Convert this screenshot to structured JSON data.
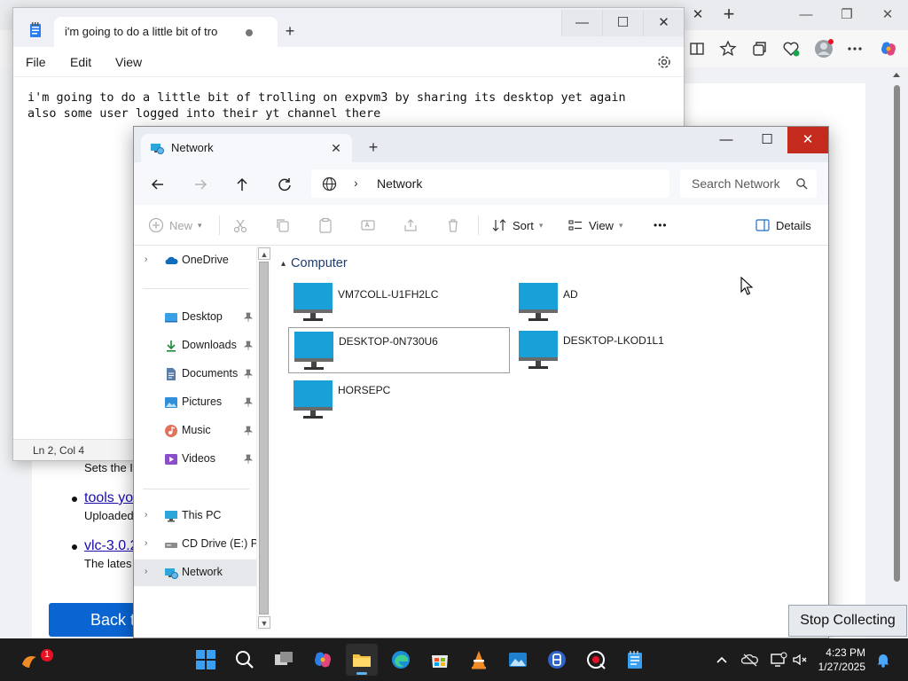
{
  "browser": {
    "tab_close": "✕",
    "new_tab": "+",
    "window_buttons": [
      "—",
      "❐",
      "✕"
    ],
    "web_texts": [
      "Sets the I",
      "Uploaded",
      "The lates"
    ],
    "links": [
      "tools yo",
      "vlc-3.0.2"
    ],
    "back_button": "Back to H"
  },
  "notepad": {
    "tab_title": "i'm going to do a little bit of tro",
    "add_tab": "+",
    "window_buttons": [
      "—",
      "☐",
      "✕"
    ],
    "menu": [
      "File",
      "Edit",
      "View"
    ],
    "text_lines": [
      "i'm going to do a little bit of trolling on expvm3 by sharing its desktop yet again",
      "also some user logged into their yt channel there"
    ],
    "status_position": "Ln 2, Col 4"
  },
  "explorer": {
    "tab_title": "Network",
    "tab_close": "✕",
    "add_tab": "+",
    "window_buttons": [
      "—",
      "☐",
      "✕"
    ],
    "address": "Network",
    "address_chevron": "›",
    "search_placeholder": "Search Network",
    "commands": {
      "new": "New",
      "sort": "Sort",
      "view": "View",
      "more": "•••",
      "details": "Details"
    },
    "nav_items": [
      {
        "label": "OneDrive",
        "icon": "cloud-icon",
        "expand": "›"
      },
      {
        "label": "Desktop",
        "icon": "desktop-folder-icon"
      },
      {
        "label": "Downloads",
        "icon": "download-icon"
      },
      {
        "label": "Documents",
        "icon": "documents-icon"
      },
      {
        "label": "Pictures",
        "icon": "pictures-icon"
      },
      {
        "label": "Music",
        "icon": "music-icon"
      },
      {
        "label": "Videos",
        "icon": "videos-icon"
      },
      {
        "label": "This PC",
        "icon": "computer-icon",
        "expand": "›"
      },
      {
        "label": "CD Drive (E:) PV",
        "icon": "cd-drive-icon",
        "expand": "›"
      },
      {
        "label": "Network",
        "icon": "network-icon",
        "expand": "›",
        "selected": true
      }
    ],
    "group_title": "Computer",
    "group_caret": "▴",
    "devices": [
      "VM7COLL-U1FH2LC",
      "AD",
      "DESKTOP-0N730U6",
      "DESKTOP-LKOD1L1",
      "HORSEPC"
    ],
    "focused_device": "DESKTOP-0N730U6"
  },
  "stop_button": "Stop Collecting",
  "taskbar": {
    "notification_badge": "1",
    "time": "4:23 PM",
    "date": "1/27/2025",
    "apps": [
      "start",
      "search",
      "task-view",
      "copilot",
      "file-explorer",
      "edge",
      "store",
      "vlc",
      "photos",
      "vpn",
      "screenshot",
      "notepad"
    ]
  },
  "colors": {
    "accent": "#0067c0",
    "close_red": "#c42b1c",
    "taskbar": "#1c1c1c",
    "monitor_blue": "#1aa0d8"
  }
}
